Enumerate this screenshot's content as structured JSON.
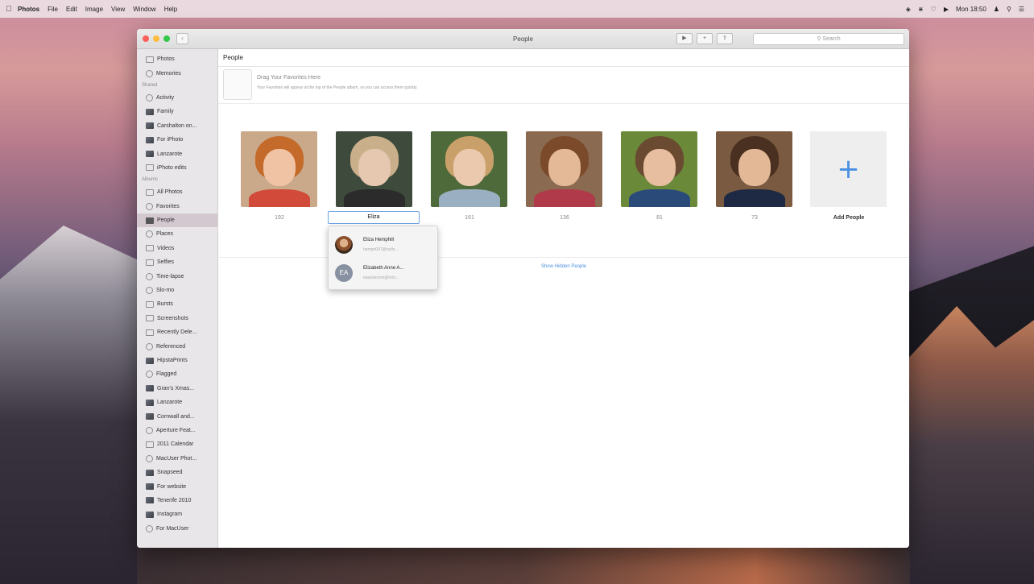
{
  "menubar": {
    "app_name": "Photos",
    "items": [
      "File",
      "Edit",
      "Image",
      "View",
      "Window",
      "Help"
    ],
    "clock": "Mon 18:50"
  },
  "window": {
    "title": "People",
    "search_placeholder": "Search"
  },
  "sidebar": {
    "top_items": [
      "Photos",
      "Memories"
    ],
    "shared_header": "Shared",
    "shared_items": [
      "Activity",
      "Family",
      "Carshalton on...",
      "For iPhoto",
      "Lanzarote",
      "iPhoto edits"
    ],
    "albums_header": "Albums",
    "album_items": [
      "All Photos",
      "Favorites",
      "People",
      "Places",
      "Videos",
      "Selfies",
      "Time-lapse",
      "Slo-mo",
      "Bursts",
      "Screenshots",
      "Recently Dele...",
      "Referenced",
      "HipstaPrints",
      "Flagged",
      "Gran's Xmas...",
      "Lanzarote",
      "Cornwall and...",
      "Aperture Feat...",
      "2011 Calendar",
      "MacUser Phot...",
      "Snapseed",
      "For website",
      "Tenerife 2010",
      "Instagram",
      "For MacUser"
    ],
    "active_item": "People"
  },
  "content": {
    "header": "People",
    "favorites_title": "Drag Your Favorites Here",
    "favorites_subtitle": "Your Favorites will appear at the top of the People album, so you can access them quickly.",
    "people": [
      {
        "count": "192"
      },
      {
        "count": "",
        "name_input": "Eliza"
      },
      {
        "count": "161"
      },
      {
        "count": "136"
      },
      {
        "count": "81"
      },
      {
        "count": "73"
      }
    ],
    "add_people_label": "Add People",
    "show_hidden": "Show Hidden People"
  },
  "suggestions": [
    {
      "name": "Eliza Hemphill",
      "email": "hempe007@outlo...",
      "avatar": "photo"
    },
    {
      "name": "Elizabeth Anne A...",
      "email": "eaanderson@micr...",
      "avatar": "EA"
    }
  ]
}
